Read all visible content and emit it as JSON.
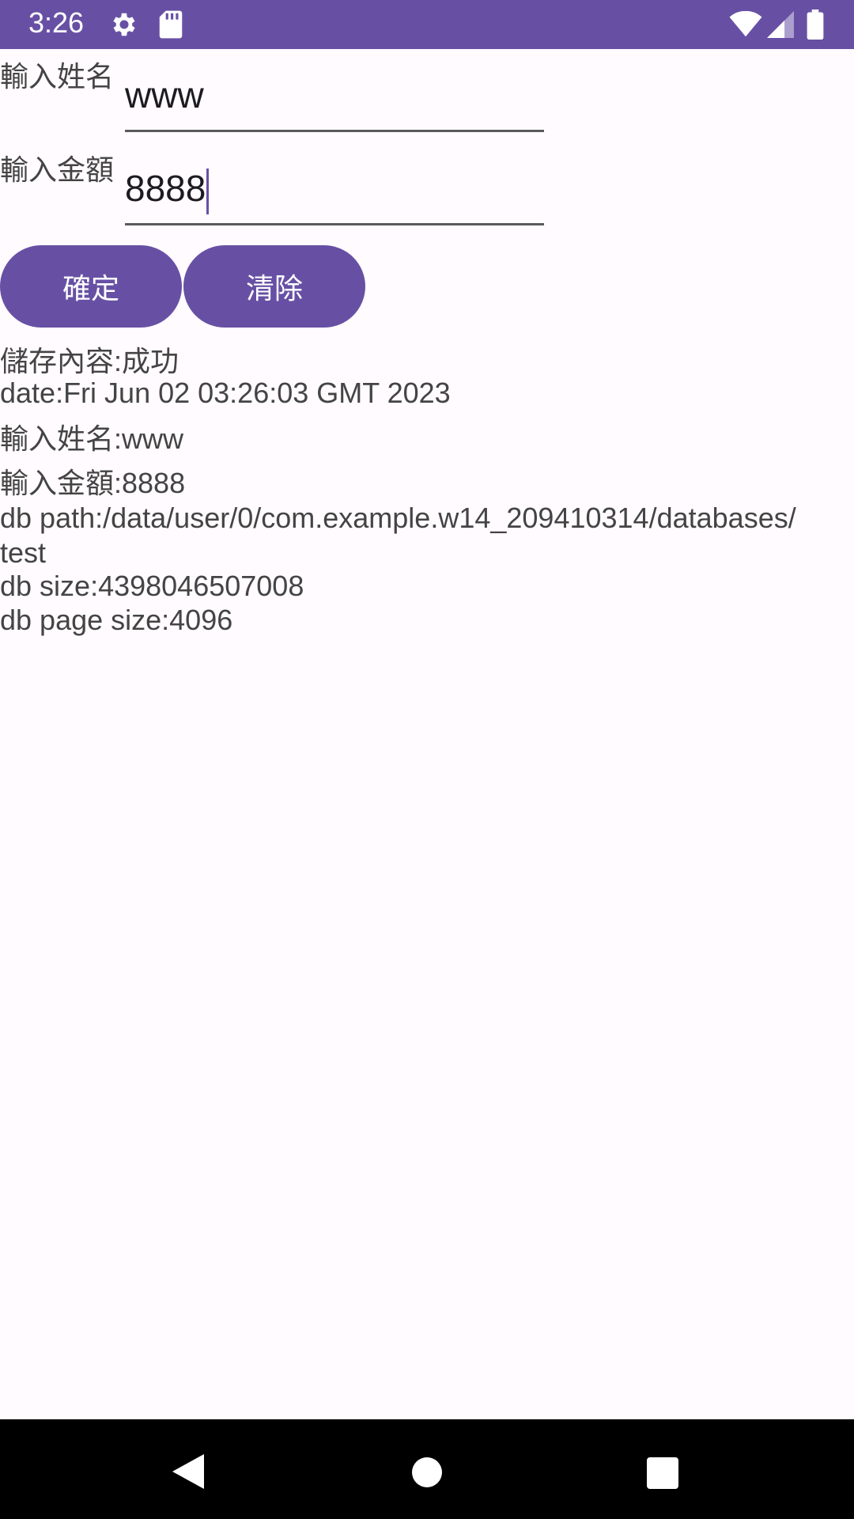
{
  "status": {
    "time": "3:26"
  },
  "form": {
    "name_label": "輸入姓名",
    "name_value": "www",
    "amount_label": "輸入金額",
    "amount_value": "8888",
    "confirm_label": "確定",
    "clear_label": "清除"
  },
  "output": {
    "save_result": "儲存內容:成功",
    "date": "date:Fri Jun 02 03:26:03 GMT 2023",
    "name": "輸入姓名:www",
    "amount": "輸入金額:8888",
    "db_path_line1": "db path:/data/user/0/com.example.w14_209410314/databases/",
    "db_path_line2": "test",
    "db_size": "db size:4398046507008",
    "db_page_size": "db page size:4096"
  },
  "colors": {
    "accent": "#6750a4",
    "background": "#fffbfe",
    "text": "#444444"
  },
  "icons": [
    "settings-icon",
    "sd-card-icon",
    "wifi-icon",
    "signal-icon",
    "battery-icon",
    "back-icon",
    "home-icon",
    "recents-icon"
  ]
}
